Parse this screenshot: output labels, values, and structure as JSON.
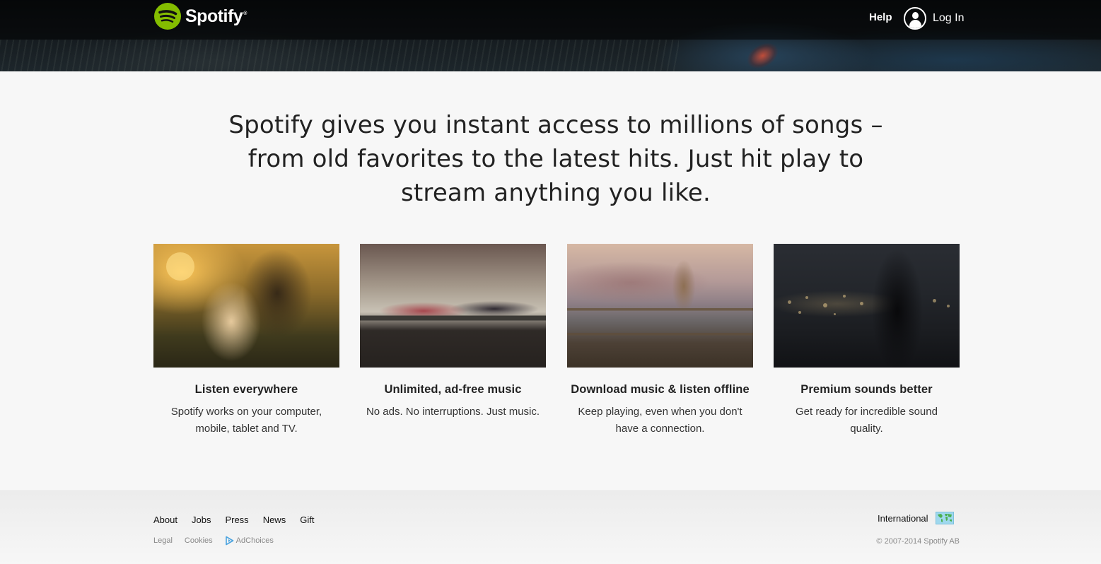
{
  "header": {
    "brand": "Spotify",
    "brand_mark": "®",
    "help_label": "Help",
    "login_label": "Log In",
    "logo_color": "#84bd00"
  },
  "main": {
    "headline": "Spotify gives you instant access to millions of songs – from old favorites to the latest hits. Just hit play to stream anything you like.",
    "features": [
      {
        "title": "Listen everywhere",
        "description": "Spotify works on your computer, mobile, tablet and TV.",
        "image": "couple-with-earphones-at-sunset-photo"
      },
      {
        "title": "Unlimited, ad-free music",
        "description": "No ads. No interruptions. Just music.",
        "image": "man-lying-on-sofa-photo"
      },
      {
        "title": "Download music & listen offline",
        "description": "Keep playing, even when you don't have a connection.",
        "image": "woman-on-fence-mountains-photo"
      },
      {
        "title": "Premium sounds better",
        "description": "Get ready for incredible sound quality.",
        "image": "saxophone-player-silhouette-photo"
      }
    ]
  },
  "footer": {
    "primary_links": [
      "About",
      "Jobs",
      "Press",
      "News",
      "Gift"
    ],
    "secondary_links": [
      "Legal",
      "Cookies",
      "AdChoices"
    ],
    "international_label": "International",
    "copyright": "© 2007-2014 Spotify AB"
  }
}
